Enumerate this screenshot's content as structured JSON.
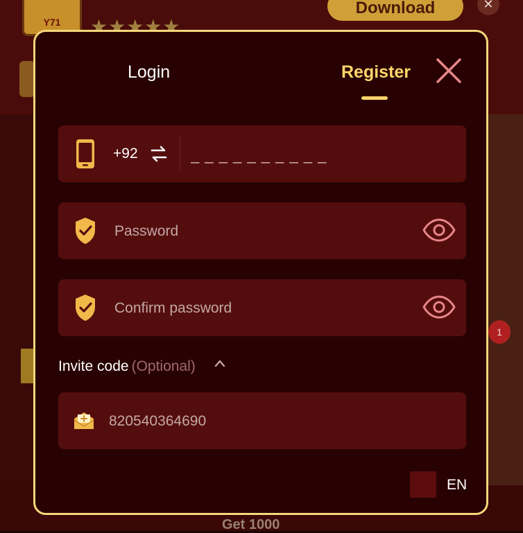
{
  "background": {
    "logo_text": "Y71",
    "stars": "★★★★★",
    "download_label": "Download",
    "close_glyph": "✕",
    "notification_count": "1",
    "bottom_promo": "Get 1000"
  },
  "modal": {
    "tabs": {
      "login": "Login",
      "register": "Register",
      "active": "register"
    },
    "phone": {
      "country_code": "+92",
      "placeholder": "_ _ _ _ _ _ _ _ _ _",
      "icon": "phone-icon",
      "swap_icon": "swap-arrows-icon"
    },
    "password": {
      "placeholder": "Password",
      "icon": "shield-check-icon",
      "toggle_icon": "eye-icon"
    },
    "confirm_password": {
      "placeholder": "Confirm password",
      "icon": "shield-check-icon",
      "toggle_icon": "eye-icon"
    },
    "invite": {
      "label": "Invite code",
      "optional": "(Optional)",
      "placeholder": "820540364690",
      "icon": "mail-plus-icon",
      "caret_icon": "chevron-up-icon"
    },
    "language": {
      "label": "EN"
    }
  },
  "colors": {
    "accent_gold": "#ffd56a",
    "modal_border": "#f5d77a",
    "field_bg": "#540d0d",
    "modal_bg": "#280202",
    "close_pink": "#e8868a"
  }
}
